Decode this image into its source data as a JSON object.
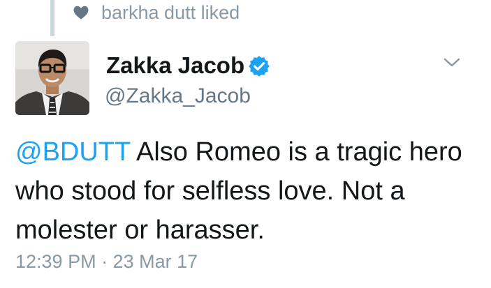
{
  "context": {
    "icon": "heart-icon",
    "text": "barkha dutt liked"
  },
  "author": {
    "name": "Zakka Jacob",
    "handle": "@Zakka_Jacob",
    "verified": true,
    "avatar": "avatar-photo"
  },
  "tweet": {
    "mention": "@BDUTT",
    "body": " Also Romeo is a tragic hero who stood for selfless love. Not a molester or harasser."
  },
  "meta": {
    "timestamp": "12:39 PM · 23 Mar 17"
  },
  "colors": {
    "accent": "#1da1f2",
    "muted": "#8899a6",
    "text": "#14171a"
  }
}
